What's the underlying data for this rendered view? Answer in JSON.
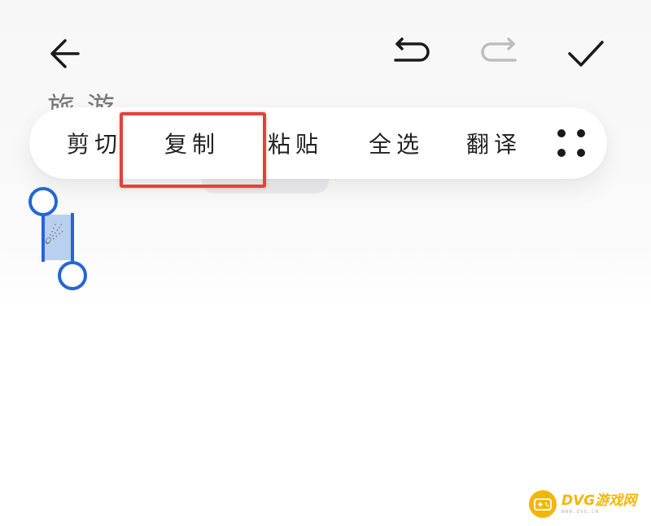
{
  "toolbar": {
    "back_icon": "arrow-left-icon",
    "undo_icon": "undo-icon",
    "redo_icon": "redo-icon",
    "redo_enabled": false,
    "done_icon": "checkmark-icon"
  },
  "note": {
    "title_fragment": "旅 游"
  },
  "context_menu": {
    "items": [
      {
        "label": "剪切"
      },
      {
        "label": "复制",
        "highlighted": true
      },
      {
        "label": "粘贴"
      },
      {
        "label": "全选"
      },
      {
        "label": "翻译"
      }
    ],
    "more_icon": "four-dots-more-icon"
  },
  "selection": {
    "selected_glyph": "☄"
  },
  "colors": {
    "accent_blue": "#2466d6",
    "highlight_red": "#e0433c",
    "watermark_yellow": "#f2b705"
  },
  "watermark": {
    "brand": "DVG游戏网",
    "url": "WWW.DVG.CN"
  }
}
